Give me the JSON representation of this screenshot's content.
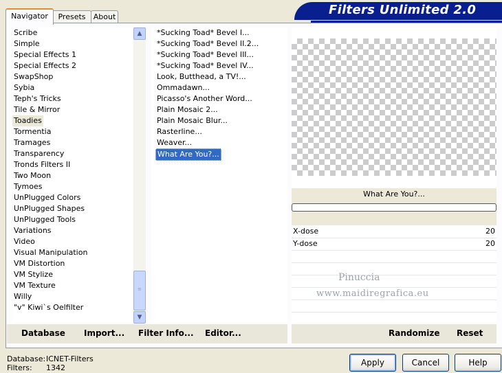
{
  "app": {
    "title": "Filters Unlimited 2.0"
  },
  "tabs": [
    {
      "label": "Navigator",
      "active": true
    },
    {
      "label": "Presets",
      "active": false
    },
    {
      "label": "About",
      "active": false
    }
  ],
  "categories": [
    "Scribe",
    "Simple",
    "Special Effects 1",
    "Special Effects 2",
    "SwapShop",
    "Sybia",
    "Teph's Tricks",
    "Tile & Mirror",
    "Toadies",
    "Tormentia",
    "Tramages",
    "Transparency",
    "Tronds Filters II",
    "Two Moon",
    "Tymoes",
    "UnPlugged Colors",
    "UnPlugged Shapes",
    "UnPlugged Tools",
    "Variations",
    "Video",
    "Visual Manipulation",
    "VM Distortion",
    "VM Stylize",
    "VM Texture",
    "Willy",
    "\"v\" Kiwi`s Oelfilter"
  ],
  "selected_category": "Toadies",
  "filters": [
    "*Sucking Toad*  Bevel I...",
    "*Sucking Toad*  Bevel II.2...",
    "*Sucking Toad*  Bevel III...",
    "*Sucking Toad*  Bevel IV...",
    "Look, Butthead, a TV!...",
    "Ommadawn...",
    "Picasso's Another Word...",
    "Plain Mosaic 2...",
    "Plain Mosaic Blur...",
    "Rasterline...",
    "Weaver...",
    "What Are You?..."
  ],
  "selected_filter": "What Are You?...",
  "preview": {
    "filter_name": "What Are You?..."
  },
  "params": [
    {
      "label": "X-dose",
      "value": "20"
    },
    {
      "label": "Y-dose",
      "value": "20"
    }
  ],
  "watermark": {
    "line1": "Pinuccia",
    "line2": "www.maidiregrafica.eu"
  },
  "bottom_links": {
    "database": "Database",
    "import": "Import...",
    "filter_info": "Filter Info...",
    "editor": "Editor...",
    "randomize": "Randomize",
    "reset": "Reset"
  },
  "status": {
    "database_label": "Database:",
    "database_value": "ICNET-Filters",
    "filters_label": "Filters:",
    "filters_value": "1342"
  },
  "buttons": {
    "apply": "Apply",
    "cancel": "Cancel",
    "help": "Help"
  },
  "icons": {
    "scroll_up": "chevron-up-icon",
    "scroll_down": "chevron-down-icon"
  }
}
